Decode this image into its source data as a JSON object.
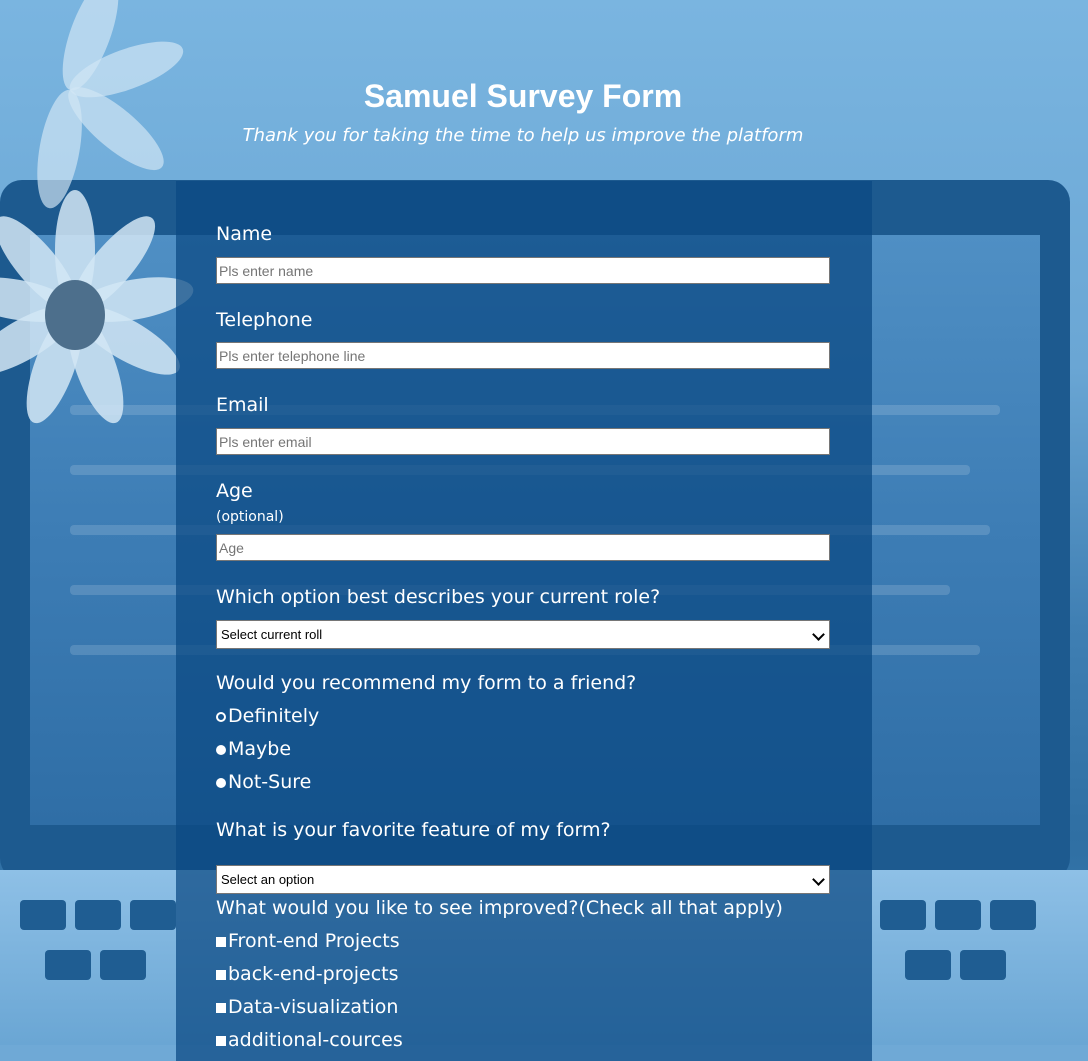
{
  "header": {
    "title": "Samuel Survey Form",
    "description": "Thank you for taking the time to help us improve the platform"
  },
  "form": {
    "name": {
      "label": "Name",
      "placeholder": "Pls enter name"
    },
    "telephone": {
      "label": "Telephone",
      "placeholder": "Pls enter telephone line"
    },
    "email": {
      "label": "Email",
      "placeholder": "Pls enter email"
    },
    "age": {
      "label": "Age",
      "hint": "(optional)",
      "placeholder": "Age"
    },
    "role": {
      "label": "Which option best describes your current role?",
      "selected": "Select current roll"
    },
    "recommend": {
      "label": "Would you recommend my form to a friend?",
      "options": [
        "Definitely",
        "Maybe",
        "Not-Sure"
      ],
      "selected_index": 0
    },
    "feature": {
      "label": "What is your favorite feature of my form?",
      "selected": "Select an option"
    },
    "improve": {
      "label": "What would you like to see improved?(Check all that apply)",
      "options": [
        "Front-end Projects",
        "back-end-projects",
        "Data-visualization",
        "additional-cources"
      ]
    }
  },
  "colors": {
    "panel": "#0a4882",
    "text": "#ffffff",
    "background": "#6fa9d6"
  }
}
